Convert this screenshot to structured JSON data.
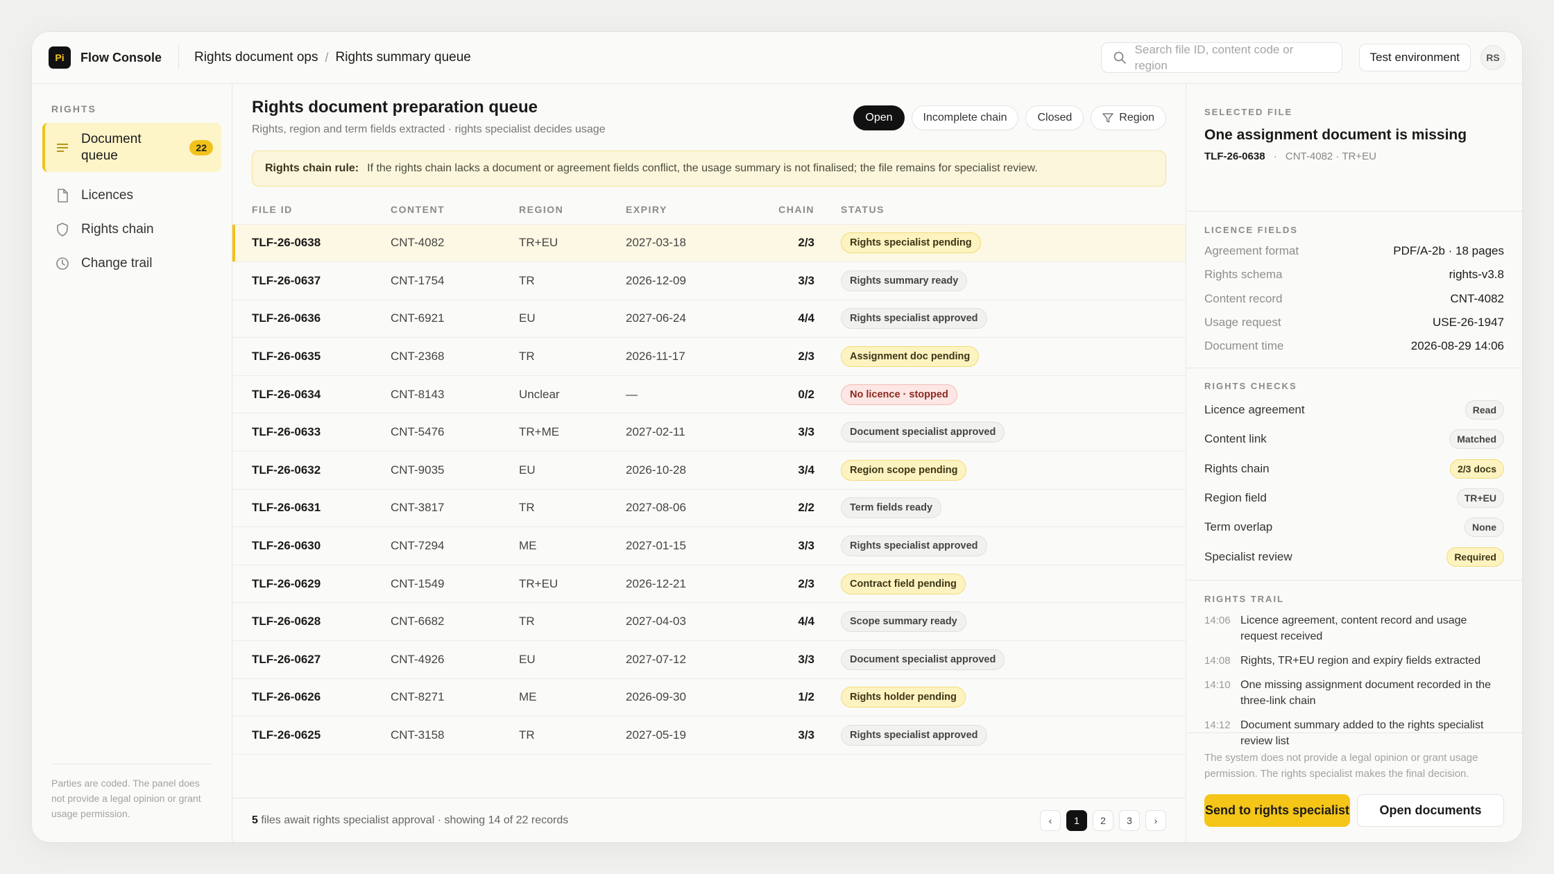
{
  "header": {
    "logo": "Pi",
    "app_name": "Flow Console",
    "breadcrumb": [
      "Rights document ops",
      "Rights summary queue"
    ],
    "search_placeholder": "Search file ID, content code or region",
    "environment": "Test environment",
    "avatar": "RS"
  },
  "sidebar": {
    "section_title": "RIGHTS",
    "items": [
      {
        "label": "Document queue",
        "badge": "22",
        "icon": "list-icon"
      },
      {
        "label": "Licences",
        "icon": "document-icon"
      },
      {
        "label": "Rights chain",
        "icon": "shield-icon"
      },
      {
        "label": "Change trail",
        "icon": "clock-icon"
      }
    ],
    "footer_note": "Parties are coded. The panel does not provide a legal opinion or grant usage permission."
  },
  "main": {
    "title": "Rights document preparation queue",
    "subtitle": "Rights, region and term fields extracted · rights specialist decides usage",
    "filters": [
      "Open",
      "Incomplete chain",
      "Closed",
      "Region"
    ],
    "rule_label": "Rights chain rule:",
    "rule_text": "If the rights chain lacks a document or agreement fields conflict, the usage summary is not finalised; the file remains for specialist review.",
    "columns": [
      "FILE ID",
      "CONTENT",
      "REGION",
      "EXPIRY",
      "CHAIN",
      "STATUS"
    ],
    "rows": [
      {
        "id": "TLF-26-0638",
        "content": "CNT-4082",
        "region": "TR+EU",
        "expiry": "2027-03-18",
        "chain": "2/3",
        "status": "Rights specialist pending",
        "tone": "warn"
      },
      {
        "id": "TLF-26-0637",
        "content": "CNT-1754",
        "region": "TR",
        "expiry": "2026-12-09",
        "chain": "3/3",
        "status": "Rights summary ready",
        "tone": "ok"
      },
      {
        "id": "TLF-26-0636",
        "content": "CNT-6921",
        "region": "EU",
        "expiry": "2027-06-24",
        "chain": "4/4",
        "status": "Rights specialist approved",
        "tone": "ok"
      },
      {
        "id": "TLF-26-0635",
        "content": "CNT-2368",
        "region": "TR",
        "expiry": "2026-11-17",
        "chain": "2/3",
        "status": "Assignment doc pending",
        "tone": "warn"
      },
      {
        "id": "TLF-26-0634",
        "content": "CNT-8143",
        "region": "Unclear",
        "expiry": "—",
        "chain": "0/2",
        "status": "No licence · stopped",
        "tone": "err"
      },
      {
        "id": "TLF-26-0633",
        "content": "CNT-5476",
        "region": "TR+ME",
        "expiry": "2027-02-11",
        "chain": "3/3",
        "status": "Document specialist approved",
        "tone": "ok"
      },
      {
        "id": "TLF-26-0632",
        "content": "CNT-9035",
        "region": "EU",
        "expiry": "2026-10-28",
        "chain": "3/4",
        "status": "Region scope pending",
        "tone": "warn"
      },
      {
        "id": "TLF-26-0631",
        "content": "CNT-3817",
        "region": "TR",
        "expiry": "2027-08-06",
        "chain": "2/2",
        "status": "Term fields ready",
        "tone": "ok"
      },
      {
        "id": "TLF-26-0630",
        "content": "CNT-7294",
        "region": "ME",
        "expiry": "2027-01-15",
        "chain": "3/3",
        "status": "Rights specialist approved",
        "tone": "ok"
      },
      {
        "id": "TLF-26-0629",
        "content": "CNT-1549",
        "region": "TR+EU",
        "expiry": "2026-12-21",
        "chain": "2/3",
        "status": "Contract field pending",
        "tone": "warn"
      },
      {
        "id": "TLF-26-0628",
        "content": "CNT-6682",
        "region": "TR",
        "expiry": "2027-04-03",
        "chain": "4/4",
        "status": "Scope summary ready",
        "tone": "ok"
      },
      {
        "id": "TLF-26-0627",
        "content": "CNT-4926",
        "region": "EU",
        "expiry": "2027-07-12",
        "chain": "3/3",
        "status": "Document specialist approved",
        "tone": "ok"
      },
      {
        "id": "TLF-26-0626",
        "content": "CNT-8271",
        "region": "ME",
        "expiry": "2026-09-30",
        "chain": "1/2",
        "status": "Rights holder pending",
        "tone": "warn"
      },
      {
        "id": "TLF-26-0625",
        "content": "CNT-3158",
        "region": "TR",
        "expiry": "2027-05-19",
        "chain": "3/3",
        "status": "Rights specialist approved",
        "tone": "ok"
      }
    ],
    "footer_count": "5",
    "footer_text": " files await rights specialist approval · showing 14 of 22 records",
    "pages": [
      "‹",
      "1",
      "2",
      "3",
      "›"
    ]
  },
  "panel": {
    "selected_title": "SELECTED FILE",
    "selected_heading": "One assignment document is missing",
    "selected_id": "TLF-26-0638",
    "selected_meta": "CNT-4082 · TR+EU",
    "licence_title": "LICENCE FIELDS",
    "licence_fields": [
      {
        "k": "Agreement format",
        "v": "PDF/A-2b · 18 pages"
      },
      {
        "k": "Rights schema",
        "v": "rights-v3.8"
      },
      {
        "k": "Content record",
        "v": "CNT-4082"
      },
      {
        "k": "Usage request",
        "v": "USE-26-1947"
      },
      {
        "k": "Document time",
        "v": "2026-08-29 14:06"
      }
    ],
    "checks_title": "RIGHTS CHECKS",
    "checks": [
      {
        "k": "Licence agreement",
        "v": "Read",
        "tone": ""
      },
      {
        "k": "Content link",
        "v": "Matched",
        "tone": ""
      },
      {
        "k": "Rights chain",
        "v": "2/3 docs",
        "tone": "warn"
      },
      {
        "k": "Region field",
        "v": "TR+EU",
        "tone": ""
      },
      {
        "k": "Term overlap",
        "v": "None",
        "tone": ""
      },
      {
        "k": "Specialist review",
        "v": "Required",
        "tone": "warn"
      }
    ],
    "trail_title": "RIGHTS TRAIL",
    "trail": [
      {
        "t": "14:06",
        "text": "Licence agreement, content record and usage request received"
      },
      {
        "t": "14:08",
        "text": "Rights, TR+EU region and expiry fields extracted"
      },
      {
        "t": "14:10",
        "text": "One missing assignment document recorded in the three-link chain"
      },
      {
        "t": "14:12",
        "text": "Document summary added to the rights specialist review list"
      }
    ],
    "footer_note": "The system does not provide a legal opinion or grant usage permission. The rights specialist makes the final decision.",
    "primary_button": "Send to rights specialist",
    "secondary_button": "Open documents"
  }
}
